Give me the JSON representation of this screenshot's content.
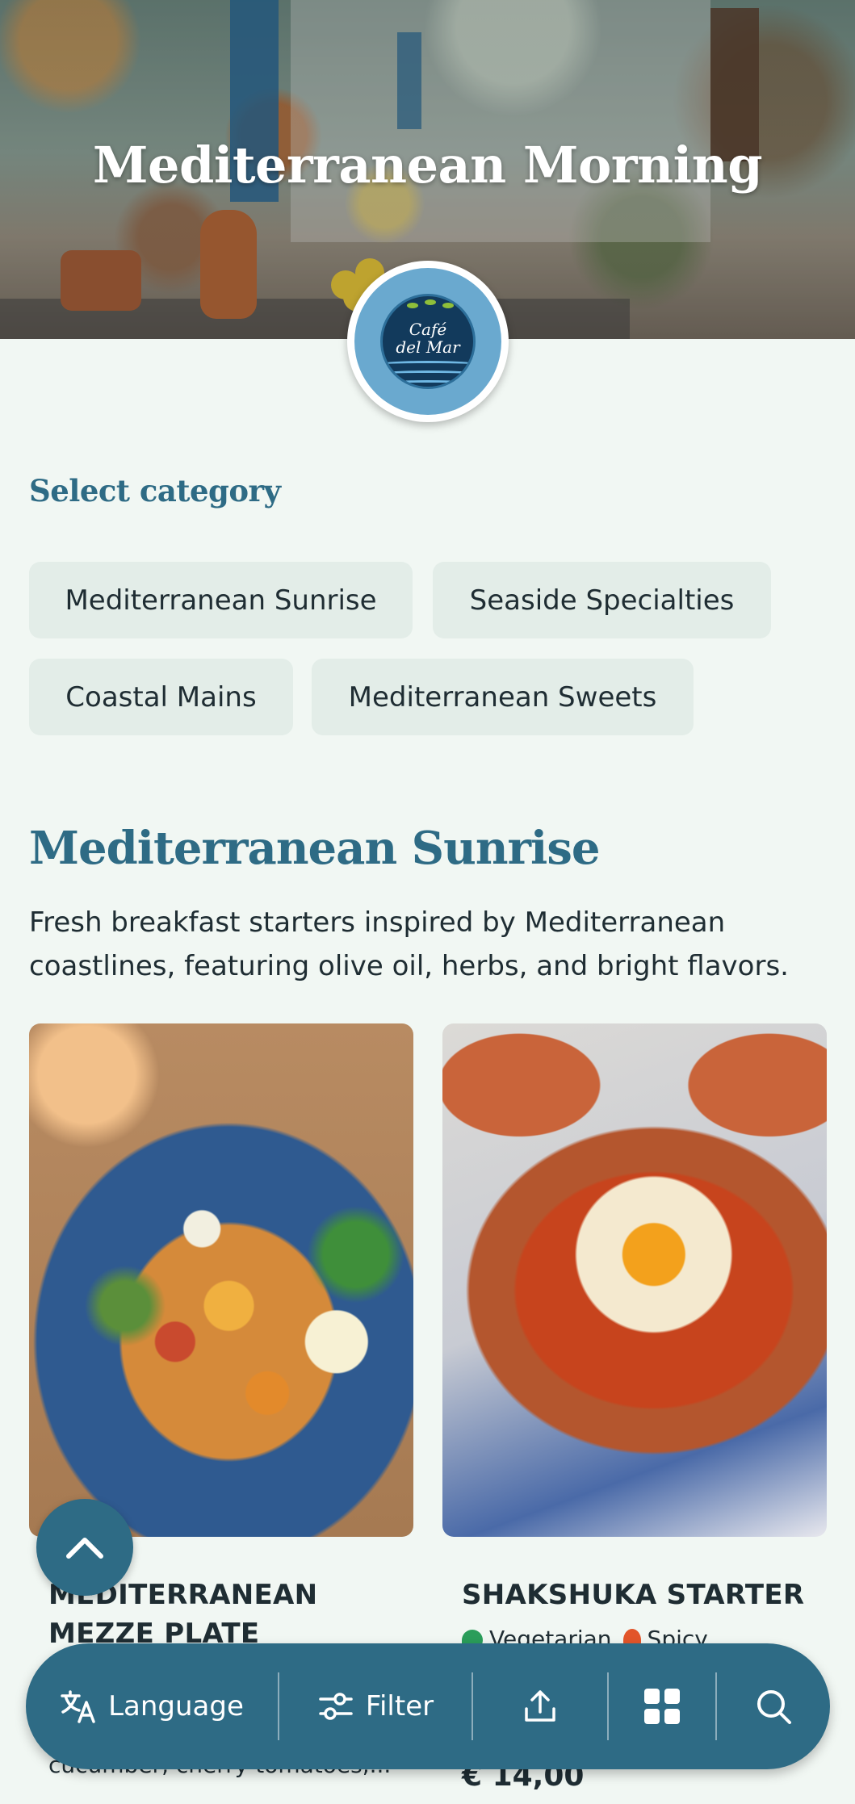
{
  "hero": {
    "title": "Mediterranean Morning",
    "logo_text_line1": "Café",
    "logo_text_line2": "del Mar"
  },
  "categories": {
    "heading": "Select category",
    "items": [
      {
        "label": "Mediterranean Sunrise"
      },
      {
        "label": "Seaside Specialties"
      },
      {
        "label": "Coastal Mains"
      },
      {
        "label": "Mediterranean Sweets"
      }
    ]
  },
  "section": {
    "title": "Mediterranean Sunrise",
    "description": "Fresh breakfast starters inspired by Mediterranean coastlines, featuring olive oil, herbs, and bright flavors."
  },
  "cards": [
    {
      "title_line1": "MEDITERRANEAN",
      "title_line2": "MEZZE PLATE",
      "description": "cucumber, cherry tomatoes,..."
    },
    {
      "title_line1": "SHAKSHUKA STARTER",
      "tags": [
        {
          "label": "Vegetarian",
          "icon": "leaf-icon"
        },
        {
          "label": "Spicy",
          "icon": "flame-icon"
        }
      ],
      "price": "€ 14,00"
    }
  ],
  "bottom_bar": {
    "language_label": "Language",
    "filter_label": "Filter",
    "icons": [
      "translate-icon",
      "filter-icon",
      "share-icon",
      "grid-icon",
      "search-icon"
    ]
  },
  "colors": {
    "accent": "#2e6b85",
    "background": "#f1f7f3",
    "chip": "#e3ede8"
  }
}
